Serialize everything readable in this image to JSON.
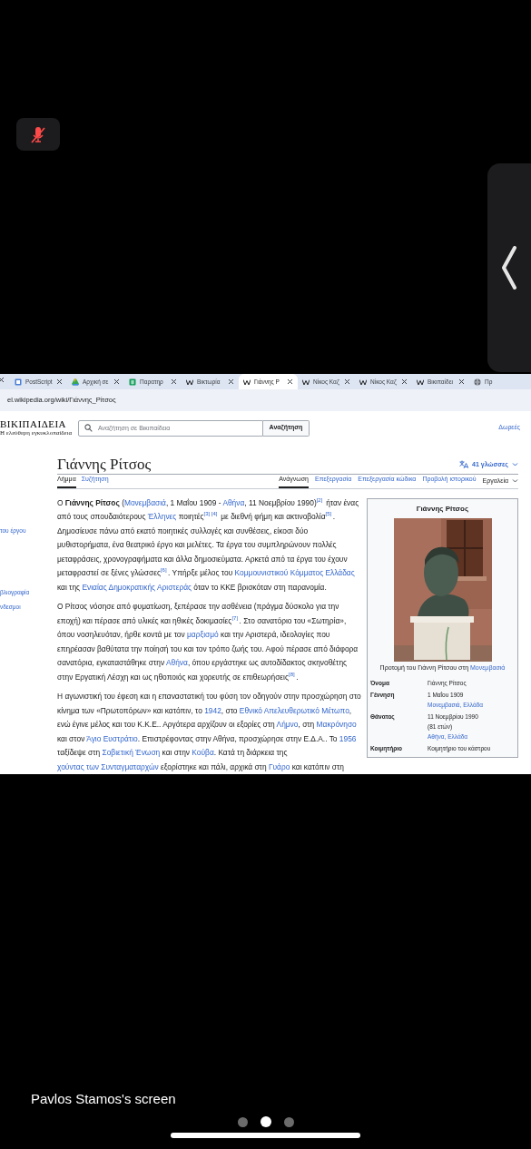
{
  "call": {
    "mic_muted": true
  },
  "browser": {
    "tabs": [
      {
        "title": "PostScript",
        "selected": false,
        "closable": true
      },
      {
        "title": "Αρχική σε",
        "selected": false,
        "closable": true
      },
      {
        "title": "Παρατηρ",
        "selected": false,
        "closable": true
      },
      {
        "title": "Βικτωρία",
        "selected": false,
        "closable": true
      },
      {
        "title": "Γιάννης Ρ",
        "selected": true,
        "closable": true
      },
      {
        "title": "Νίκος Καζ",
        "selected": false,
        "closable": true
      },
      {
        "title": "Νίκος Καζ",
        "selected": false,
        "closable": true
      },
      {
        "title": "Βικιπαίδει",
        "selected": false,
        "closable": true
      },
      {
        "title": "Πρ",
        "selected": false,
        "closable": false
      }
    ],
    "url": "el.wikipedia.org/wiki/Γιάννης_Ρίτσος"
  },
  "wiki": {
    "logo": {
      "wordmark": "ΒΙΚΙΠΑΙΔΕΙΑ",
      "tagline": "Η ελεύθερη εγκυκλοπαίδεια"
    },
    "search": {
      "placeholder": "Αναζήτηση σε Βικιπαίδεια",
      "button": "Αναζήτηση"
    },
    "user_links": [
      "Δωρεές"
    ],
    "sidebar_links": [
      "του έργου",
      "βλιογραφία",
      "νδεσμοι"
    ],
    "title": "Γιάννης Ρίτσος",
    "languages": "41 γλώσσες",
    "namespace_tabs": [
      {
        "label": "Λήμμα",
        "selected": true
      },
      {
        "label": "Συζήτηση",
        "selected": false
      }
    ],
    "view_tabs": [
      {
        "label": "Ανάγνωση",
        "selected": true
      },
      {
        "label": "Επεξεργασία",
        "selected": false
      },
      {
        "label": "Επεξεργασία κώδικα",
        "selected": false
      },
      {
        "label": "Προβολή ιστορικού",
        "selected": false
      }
    ],
    "tools": "Εργαλεία",
    "paragraphs": [
      [
        {
          "kind": "text",
          "text": "Ο "
        },
        {
          "kind": "bold",
          "text": "Γιάννης Ρίτσος"
        },
        {
          "kind": "text",
          "text": " ("
        },
        {
          "kind": "link",
          "text": "Μονεμβασιά"
        },
        {
          "kind": "text",
          "text": ", 1 Μαΐου 1909 - "
        },
        {
          "kind": "link",
          "text": "Αθήνα"
        },
        {
          "kind": "text",
          "text": ", 11 Νοεμβρίου 1990)"
        },
        {
          "kind": "ref",
          "text": "[2]"
        },
        {
          "kind": "text",
          "text": " ήταν ένας από τους σπουδαιότερους "
        },
        {
          "kind": "link",
          "text": "Έλληνες"
        },
        {
          "kind": "text",
          "text": " ποιητές"
        },
        {
          "kind": "ref",
          "text": "[3]"
        },
        {
          "kind": "ref",
          "text": "[4]"
        },
        {
          "kind": "text",
          "text": " με διεθνή φήμη και ακτινοβολία"
        },
        {
          "kind": "ref",
          "text": "[5]"
        },
        {
          "kind": "text",
          "text": ". Δημοσίευσε πάνω από εκατό ποιητικές συλλογές και συνθέσεις, είκοσι δύο μυθιστορήματα, ένα θεατρικό έργο και μελέτες. Τα έργα του συμπληρώνουν πολλές μεταφράσεις, χρονογραφήματα και άλλα δημοσιεύματα. Αρκετά από τα έργα του έχουν μεταφραστεί σε ξένες γλώσσες"
        },
        {
          "kind": "ref",
          "text": "[6]"
        },
        {
          "kind": "text",
          "text": ". Υπήρξε μέλος του "
        },
        {
          "kind": "link",
          "text": "Κομμουνιστικού Κόμματος Ελλάδας"
        },
        {
          "kind": "text",
          "text": " και της "
        },
        {
          "kind": "link",
          "text": "Ενιαίας Δημοκρατικής Αριστεράς"
        },
        {
          "kind": "text",
          "text": " όταν το ΚΚΕ βρισκόταν στη παρανομία."
        }
      ],
      [
        {
          "kind": "text",
          "text": "Ο Ρίτσος νόσησε από φυματίωση, ξεπέρασε την ασθένεια (πράγμα δύσκολο για την εποχή) και πέρασε από υλικές και ηθικές δοκιμασίες"
        },
        {
          "kind": "ref",
          "text": "[7]"
        },
        {
          "kind": "text",
          "text": ". Στο σανατόριο του «Σωτηρία», όπου νοσηλευόταν, ήρθε κοντά με τον "
        },
        {
          "kind": "link",
          "text": "μαρξισμό"
        },
        {
          "kind": "text",
          "text": " και την Αριστερά, ιδεολογίες που επηρέασαν βαθύτατα την ποίησή του και τον τρόπο ζωής του. Αφού πέρασε από διάφορα σανατόρια, εγκαταστάθηκε στην "
        },
        {
          "kind": "link",
          "text": "Αθήνα"
        },
        {
          "kind": "text",
          "text": ", όπου εργάστηκε ως αυτοδίδακτος σκηνοθέτης στην Εργατική Λέσχη και ως ηθοποιός και χορευτής σε επιθεωρήσεις"
        },
        {
          "kind": "ref",
          "text": "[8]"
        },
        {
          "kind": "text",
          "text": "."
        }
      ],
      [
        {
          "kind": "text",
          "text": "Η αγωνιστική του έφεση και η επαναστατική του φύση τον οδηγούν στην προσχώρηση στο κίνημα των «Πρωτοπόρων» και κατόπιν, το "
        },
        {
          "kind": "link",
          "text": "1942"
        },
        {
          "kind": "text",
          "text": ", στο "
        },
        {
          "kind": "link",
          "text": "Εθνικό Απελευθερωτικό Μέτωπο"
        },
        {
          "kind": "text",
          "text": ", ενώ έγινε μέλος και του Κ.Κ.Ε.. Αργότερα αρχίζουν οι εξορίες στη "
        },
        {
          "kind": "link",
          "text": "Λήμνο"
        },
        {
          "kind": "text",
          "text": ", στη "
        },
        {
          "kind": "link",
          "text": "Μακρόνησο"
        },
        {
          "kind": "text",
          "text": " και στον "
        },
        {
          "kind": "link",
          "text": "Άγιο Ευστράτιο"
        },
        {
          "kind": "text",
          "text": ". Επιστρέφοντας στην Αθήνα, προσχώρησε στην Ε.Δ.Α.. Το "
        },
        {
          "kind": "link",
          "text": "1956"
        },
        {
          "kind": "text",
          "text": " ταξίδεψε στη "
        },
        {
          "kind": "link",
          "text": "Σοβιετική Ένωση"
        },
        {
          "kind": "text",
          "text": " και στην "
        },
        {
          "kind": "link",
          "text": "Κούβα"
        },
        {
          "kind": "text",
          "text": ". Κατά τη διάρκεια της "
        },
        {
          "kind": "link",
          "text": "χούντας των Συνταγματαρχών"
        },
        {
          "kind": "text",
          "text": " εξορίστηκε και πάλι, αρχικά στη "
        },
        {
          "kind": "link",
          "text": "Γυάρο"
        },
        {
          "kind": "text",
          "text": " και κατόπιν στη"
        }
      ]
    ],
    "infobox": {
      "title": "Γιάννης Ρίτσος",
      "caption": [
        {
          "kind": "text",
          "text": "Προτομή του Γιάννη Ρίτσου στη "
        },
        {
          "kind": "link",
          "text": "Μονεμβασιά"
        }
      ],
      "rows": [
        {
          "label": "Όνομα",
          "values": [
            {
              "kind": "text",
              "text": "Γιάννης Ρίτσος"
            }
          ]
        },
        {
          "label": "Γέννηση",
          "values": [
            {
              "kind": "text",
              "text": "1 Μαΐου 1909"
            },
            {
              "kind": "link",
              "text": "Μονεμβασιά, Ελλάδα"
            }
          ]
        },
        {
          "label": "Θάνατος",
          "values": [
            {
              "kind": "text",
              "text": "11 Νοεμβρίου 1990"
            },
            {
              "kind": "text",
              "text": "(81 ετών)"
            },
            {
              "kind": "link",
              "text": "Αθήνα, Ελλάδα"
            }
          ]
        },
        {
          "label": "Κοιμητήριο",
          "values": [
            {
              "kind": "text",
              "text": "Κοιμητήριο του κάστρου"
            }
          ]
        }
      ]
    }
  },
  "share_label": "Pavlos Stamos's screen",
  "page_dots": [
    {
      "selected": false
    },
    {
      "selected": true
    },
    {
      "selected": false
    }
  ]
}
